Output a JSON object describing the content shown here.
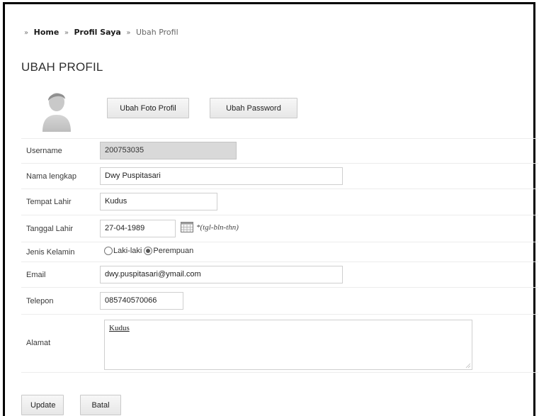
{
  "breadcrumb": {
    "items": [
      {
        "label": "Home"
      },
      {
        "label": "Profil Saya"
      },
      {
        "label": "Ubah Profil"
      }
    ]
  },
  "page": {
    "title": "UBAH PROFIL"
  },
  "profile_actions": {
    "change_photo_label": "Ubah Foto Profil",
    "change_password_label": "Ubah Password"
  },
  "form": {
    "username": {
      "label": "Username",
      "value": "200753035"
    },
    "full_name": {
      "label": "Nama lengkap",
      "value": "Dwy Puspitasari"
    },
    "birth_place": {
      "label": "Tempat Lahir",
      "value": "Kudus"
    },
    "birth_date": {
      "label": "Tanggal Lahir",
      "value": "27-04-1989",
      "hint": "*(tgl-bln-thn)"
    },
    "gender": {
      "label": "Jenis Kelamin",
      "options": [
        {
          "label": "Laki-laki",
          "selected": false
        },
        {
          "label": "Perempuan",
          "selected": true
        }
      ]
    },
    "email": {
      "label": "Email",
      "value": "dwy.puspitasari@ymail.com"
    },
    "phone": {
      "label": "Telepon",
      "value": "085740570066"
    },
    "address": {
      "label": "Alamat",
      "value": "Kudus"
    }
  },
  "actions": {
    "update_label": "Update",
    "cancel_label": "Batal"
  },
  "icons": {
    "breadcrumb_separator": "chevron-right-icon",
    "avatar": "user-avatar-icon",
    "calendar": "calendar-icon"
  }
}
